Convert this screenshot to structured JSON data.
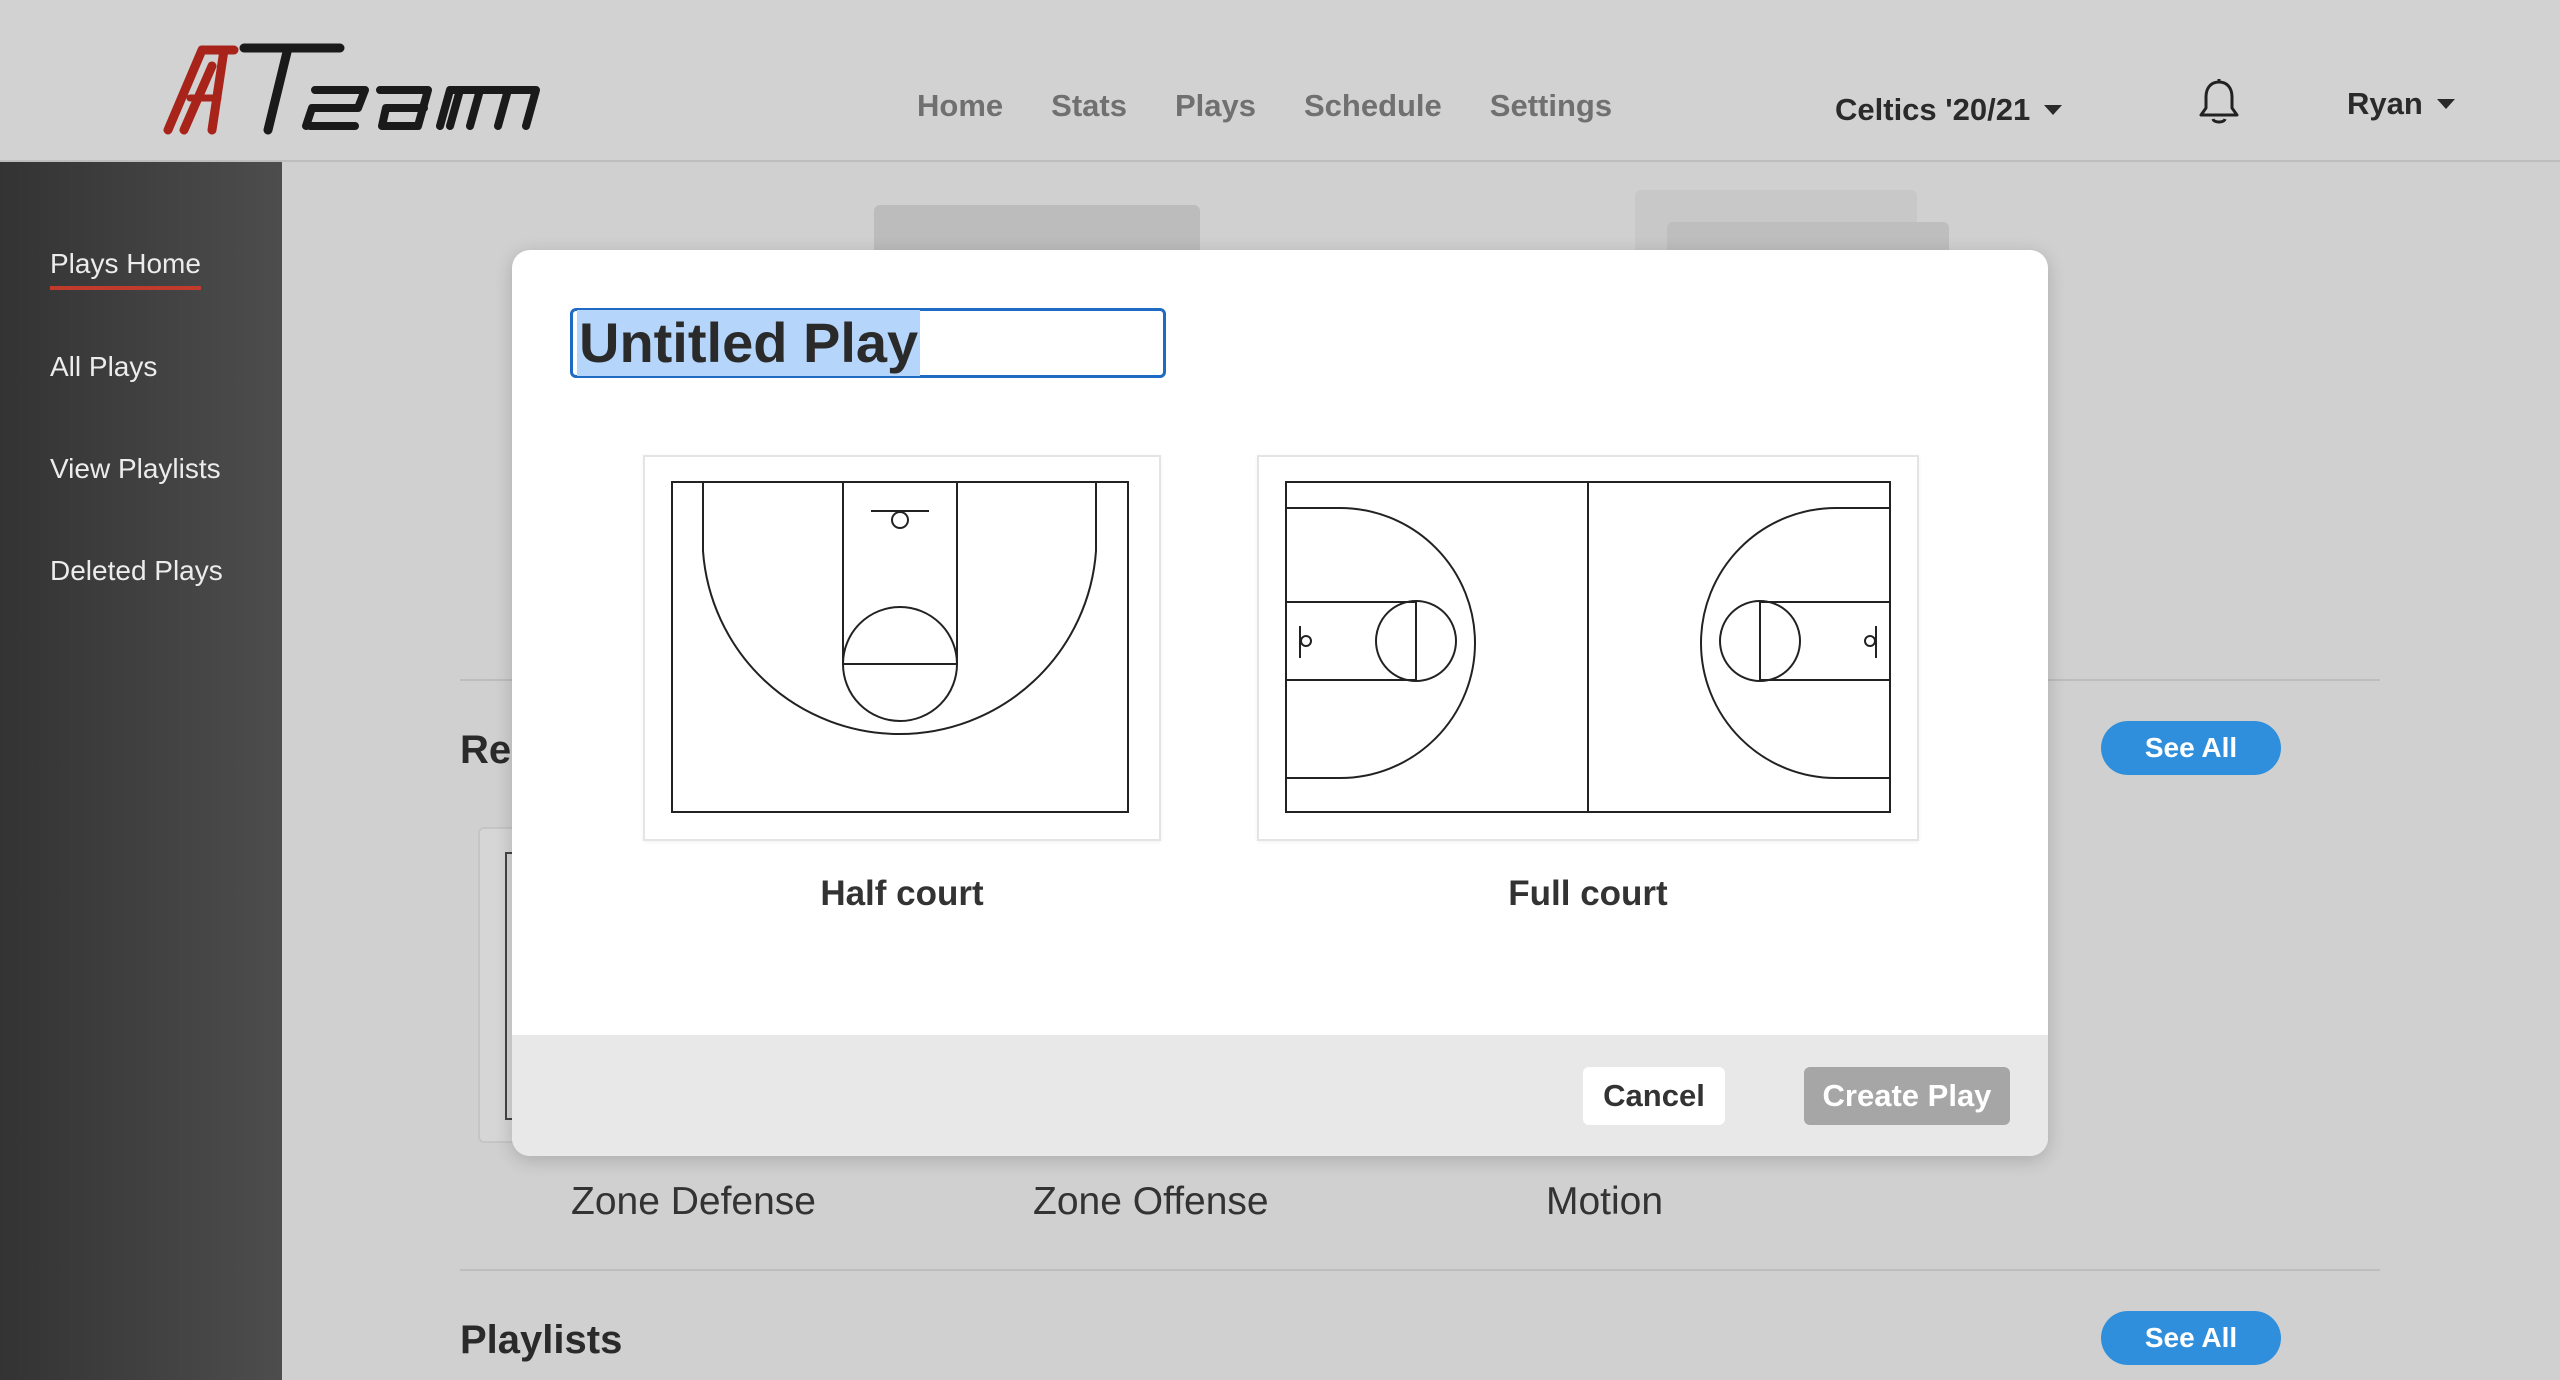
{
  "header": {
    "logo_text": "ATeam",
    "nav": [
      "Home",
      "Stats",
      "Plays",
      "Schedule",
      "Settings"
    ],
    "team": "Celtics '20/21",
    "user": "Ryan"
  },
  "sidebar": {
    "items": [
      {
        "label": "Plays Home"
      },
      {
        "label": "All Plays"
      },
      {
        "label": "View Playlists"
      },
      {
        "label": "Deleted Plays"
      }
    ]
  },
  "main": {
    "recent_title_fragment": "Re",
    "see_all_label": "See All",
    "play_labels": [
      "Zone Defense",
      "Zone Offense",
      "Motion"
    ],
    "playlists_title": "Playlists"
  },
  "modal": {
    "play_title": "Untitled Play",
    "options": [
      {
        "label": "Half court"
      },
      {
        "label": "Full court"
      }
    ],
    "cancel_label": "Cancel",
    "create_label": "Create Play"
  },
  "colors": {
    "accent_blue": "#2f8fdc",
    "logo_red": "#a8231a",
    "active_underline": "#c23a2a",
    "disabled_button": "#a6a6a6"
  },
  "icons": [
    "bell-icon",
    "caret-down-icon",
    "half-court-icon",
    "full-court-icon"
  ]
}
